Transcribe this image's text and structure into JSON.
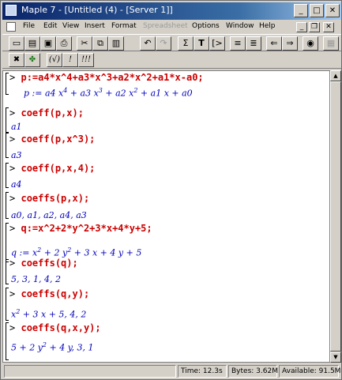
{
  "window": {
    "title": "Maple 7 - [Untitled (4) - [Server 1]]"
  },
  "menu": [
    "File",
    "Edit",
    "View",
    "Insert",
    "Format",
    "Spreadsheet",
    "Options",
    "Window",
    "Help"
  ],
  "worksheet": [
    {
      "kind": "cmd",
      "text": "p:=a4*x^4+a3*x^3+a2*x^2+a1*x-a0;"
    },
    {
      "kind": "cmd",
      "text": "coeff(p,x);"
    },
    {
      "kind": "out",
      "text": "a1"
    },
    {
      "kind": "cmd",
      "text": "coeff(p,x^3);"
    },
    {
      "kind": "out",
      "text": "a3"
    },
    {
      "kind": "cmd",
      "text": "coeff(p,x,4);"
    },
    {
      "kind": "out",
      "text": "a4"
    },
    {
      "kind": "cmd",
      "text": "coeffs(p,x);"
    },
    {
      "kind": "out",
      "text": "a0, a1, a2, a4, a3"
    },
    {
      "kind": "cmd",
      "text": "q:=x^2+2*y^2+3*x+4*y+5;"
    },
    {
      "kind": "cmd",
      "text": "coeffs(q);"
    },
    {
      "kind": "out",
      "text": "5, 3, 1, 4, 2"
    },
    {
      "kind": "cmd",
      "text": "coeffs(q,y);"
    },
    {
      "kind": "cmd",
      "text": "coeffs(q,x,y);"
    }
  ],
  "prompt": ">",
  "status": {
    "time": "Time: 12.3s",
    "bytes": "Bytes: 3.62M",
    "available": "Available: 91.5M"
  }
}
